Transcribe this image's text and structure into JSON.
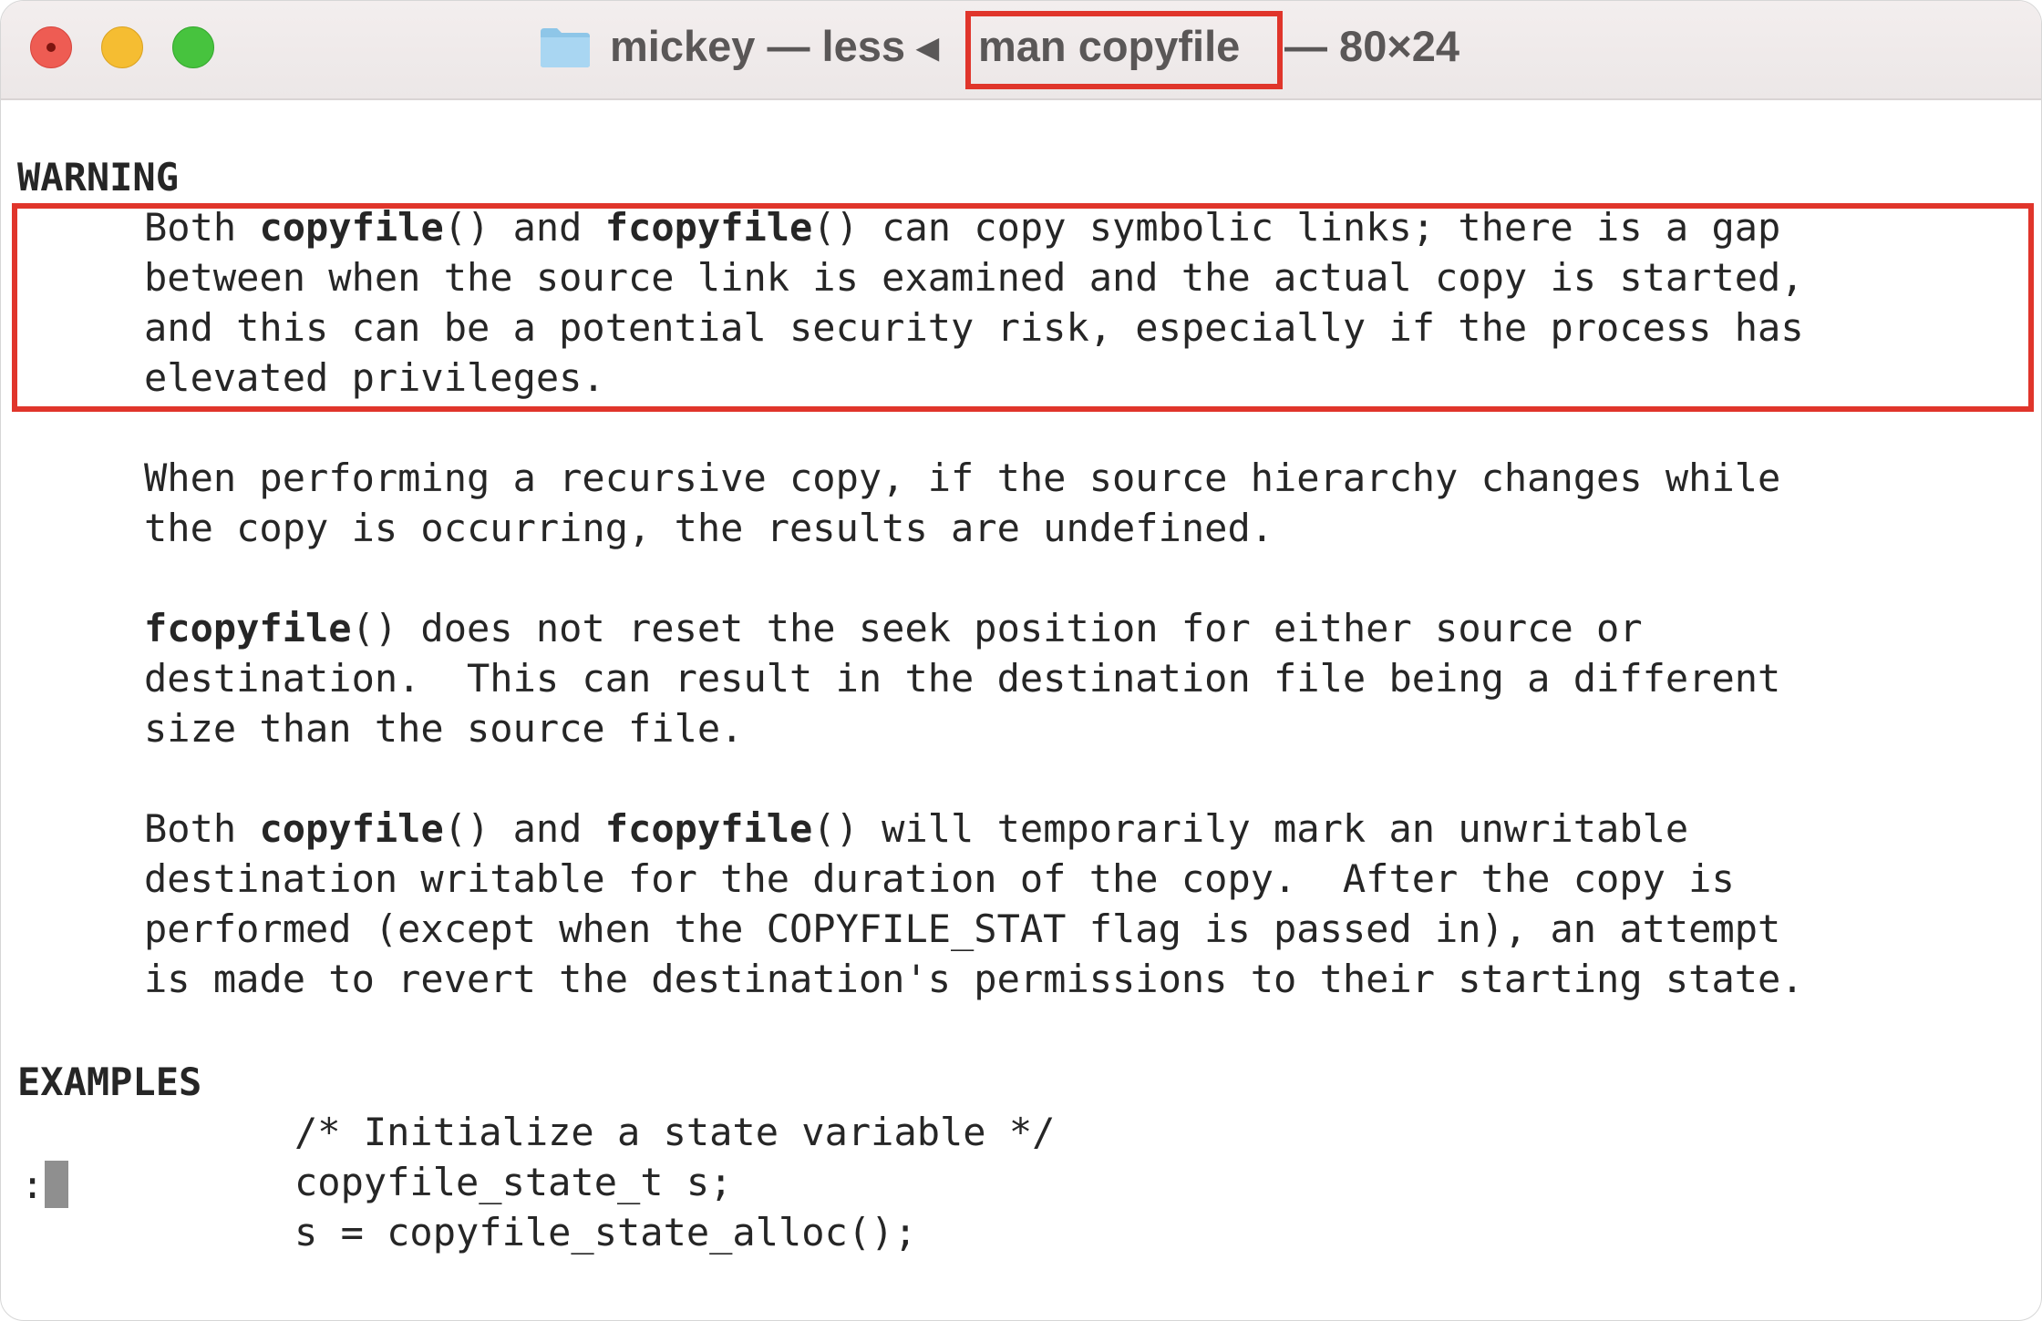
{
  "window": {
    "title_prefix": "mickey — less ◂",
    "title_command": "man copyfile",
    "title_size": "— 80×24"
  },
  "manpage": {
    "warning_heading": "WARNING",
    "warning": {
      "p1": [
        [
          "Both ",
          "copyfile",
          "() and ",
          "fcopyfile",
          "() can copy symbolic links; there is a gap"
        ],
        [
          "between when the source link is examined and the actual copy is started,"
        ],
        [
          "and this can be a potential security risk, especially if the process has"
        ],
        [
          "elevated privileges."
        ]
      ],
      "p2": [
        [
          "When performing a recursive copy, if the source hierarchy changes while"
        ],
        [
          "the copy is occurring, the results are undefined."
        ]
      ],
      "p3": [
        [
          "fcopyfile",
          "() does not reset the seek position for either source or"
        ],
        [
          "destination.  This can result in the destination file being a different"
        ],
        [
          "size than the source file."
        ]
      ],
      "p4": [
        [
          "Both ",
          "copyfile",
          "() and ",
          "fcopyfile",
          "() will temporarily mark an unwritable"
        ],
        [
          "destination writable for the duration of the copy.  After the copy is"
        ],
        [
          "performed (except when the COPYFILE_STAT flag is passed in), an attempt"
        ],
        [
          "is made to revert the destination's permissions to their starting state."
        ]
      ]
    },
    "examples_heading": "EXAMPLES",
    "examples": [
      "/* Initialize a state variable */",
      "copyfile_state_t s;",
      "s = copyfile_state_alloc();"
    ]
  },
  "pager": {
    "prompt": ":"
  },
  "colors": {
    "highlight": "#e0352b",
    "close": "#ee5c53",
    "minimize": "#f5bd32",
    "zoom": "#47c33e"
  }
}
